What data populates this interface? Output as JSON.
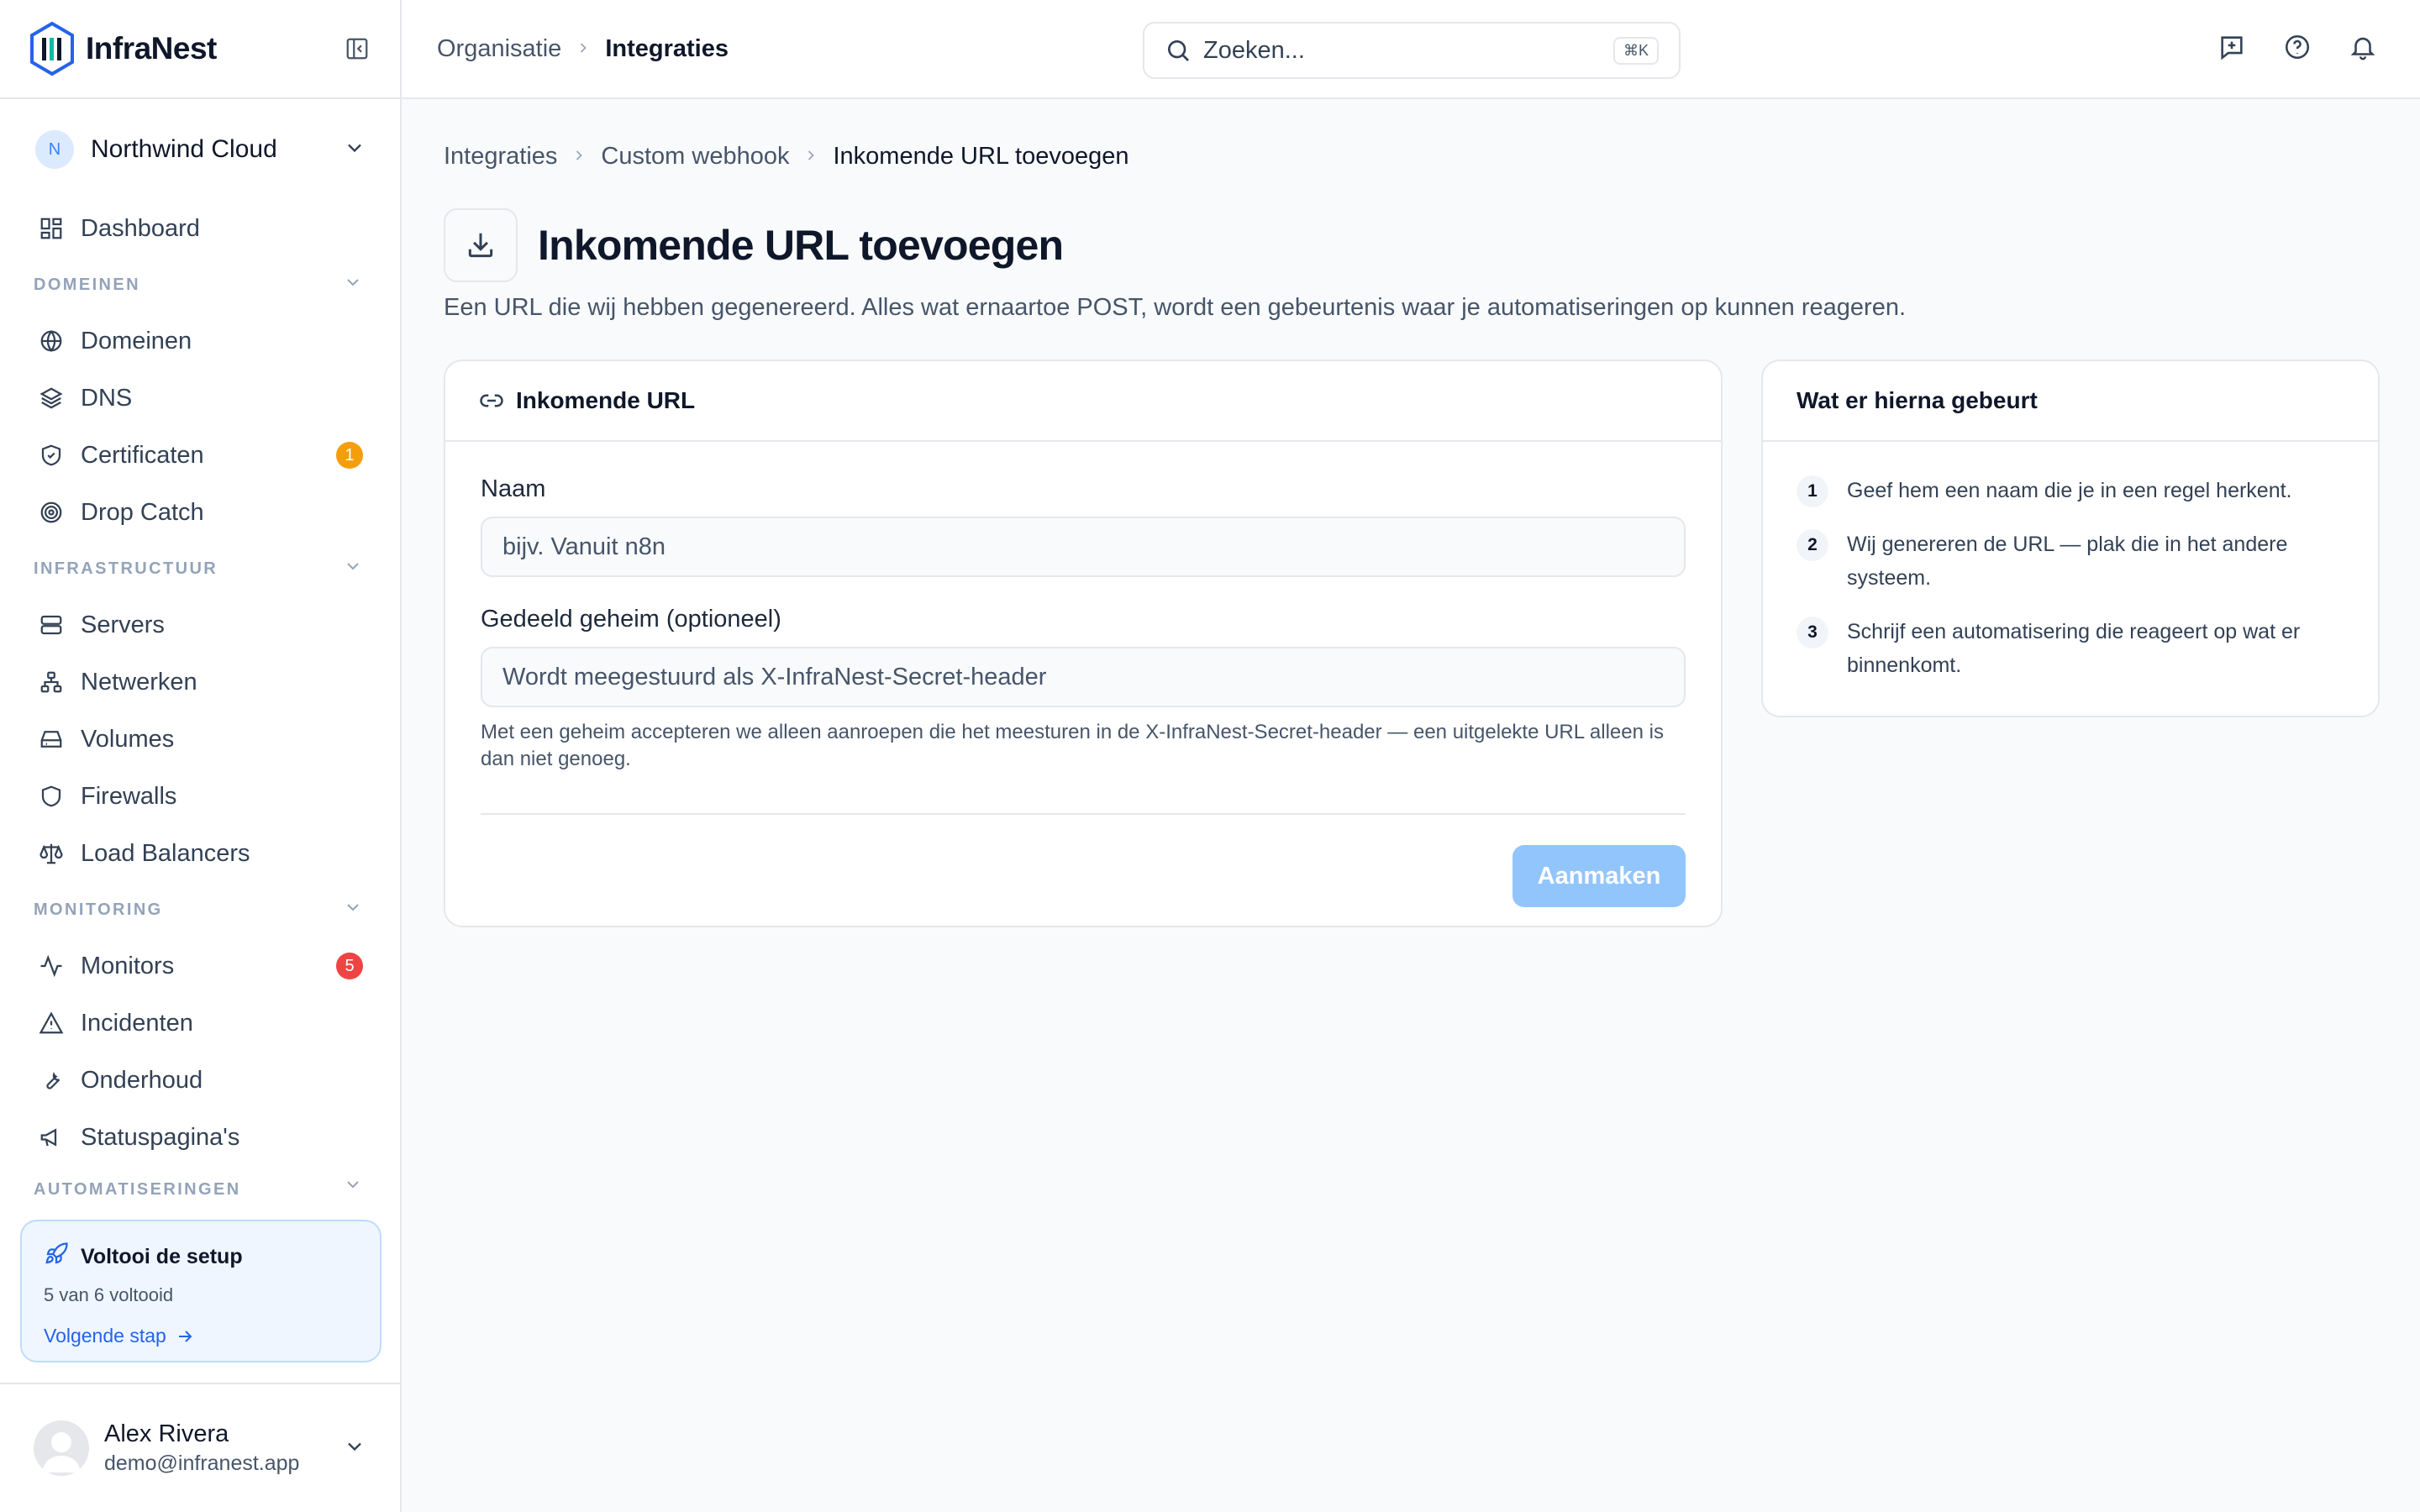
{
  "app": {
    "name": "InfraNest"
  },
  "org": {
    "avatar": "N",
    "name": "Northwind Cloud"
  },
  "nav": {
    "dashboard": "Dashboard",
    "sections": {
      "domains": "DOMEINEN",
      "infra": "INFRASTRUCTUUR",
      "monitoring": "MONITORING",
      "automation": "AUTOMATISERINGEN"
    },
    "items": {
      "domains": "Domeinen",
      "dns": "DNS",
      "certificates": "Certificaten",
      "certificates_badge": "1",
      "dropcatch": "Drop Catch",
      "servers": "Servers",
      "networks": "Netwerken",
      "volumes": "Volumes",
      "firewalls": "Firewalls",
      "loadbalancers": "Load Balancers",
      "monitors": "Monitors",
      "monitors_badge": "5",
      "incidents": "Incidenten",
      "maintenance": "Onderhoud",
      "statuspages": "Statuspagina's"
    }
  },
  "setup": {
    "title": "Voltooi de setup",
    "progress": "5 van 6 voltooid",
    "next": "Volgende stap"
  },
  "user": {
    "name": "Alex Rivera",
    "email": "demo@infranest.app"
  },
  "topbar": {
    "crumbs": [
      "Organisatie",
      "Integraties"
    ],
    "search_placeholder": "Zoeken...",
    "search_shortcut": "⌘K"
  },
  "page": {
    "crumbs": [
      "Integraties",
      "Custom webhook",
      "Inkomende URL toevoegen"
    ],
    "title": "Inkomende URL toevoegen",
    "description": "Een URL die wij hebben gegenereerd. Alles wat ernaartoe POST, wordt een gebeurtenis waar je automatiseringen op kunnen reageren."
  },
  "form": {
    "card_title": "Inkomende URL",
    "name_label": "Naam",
    "name_placeholder": "bijv. Vanuit n8n",
    "secret_label": "Gedeeld geheim (optioneel)",
    "secret_placeholder": "Wordt meegestuurd als X-InfraNest-Secret-header",
    "secret_help": "Met een geheim accepteren we alleen aanroepen die het meesturen in de X-InfraNest-Secret-header — een uitgelekte URL alleen is dan niet genoeg.",
    "submit": "Aanmaken"
  },
  "next_steps": {
    "title": "Wat er hierna gebeurt",
    "steps": [
      {
        "num": "1",
        "text": "Geef hem een naam die je in een regel herkent."
      },
      {
        "num": "2",
        "text": "Wij genereren de URL — plak die in het andere systeem."
      },
      {
        "num": "3",
        "text": "Schrijf een automatisering die reageert op wat er binnenkomt."
      }
    ]
  },
  "colors": {
    "accent": "#2563eb",
    "button_disabled": "#93c5fd",
    "badge_warning": "#f59e0b",
    "badge_danger": "#ef4444"
  }
}
